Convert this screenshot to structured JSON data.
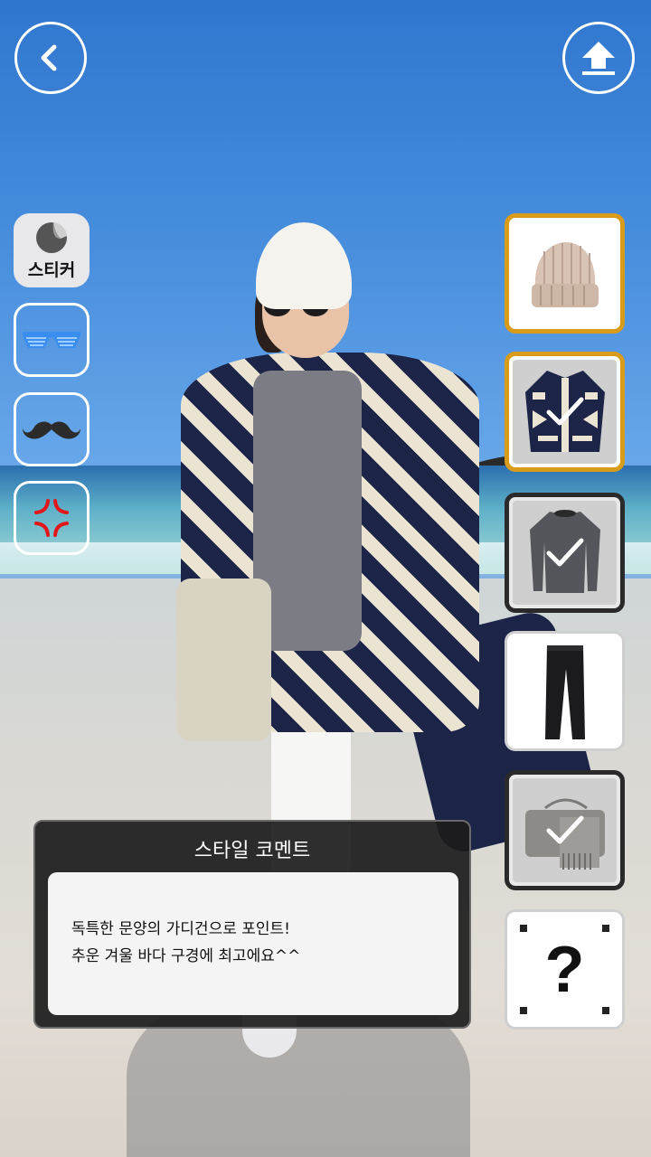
{
  "header": {
    "back_icon": "chevron-left-icon",
    "upload_icon": "upload-icon"
  },
  "stickers": {
    "main_label": "스티커",
    "items": [
      {
        "icon": "glasses-icon"
      },
      {
        "icon": "mustache-icon"
      },
      {
        "icon": "anger-mark-icon"
      }
    ]
  },
  "outfit_items": [
    {
      "name": "beanie",
      "selected": false,
      "highlight": true
    },
    {
      "name": "cardigan",
      "selected": true,
      "highlight": true
    },
    {
      "name": "sweater",
      "selected": true,
      "highlight": false
    },
    {
      "name": "jeans",
      "selected": false,
      "highlight": false
    },
    {
      "name": "bag",
      "selected": true,
      "highlight": false
    },
    {
      "name": "mystery",
      "selected": false,
      "highlight": false
    }
  ],
  "mystery_symbol": "?",
  "comment": {
    "title": "스타일 코멘트",
    "line1": "독특한 문양의 가디건으로 포인트!",
    "line2": "추운 겨울 바다 구경에 최고에요^^"
  },
  "colors": {
    "accent_gold": "#d89b1a",
    "dark_border": "#2a2a2a",
    "sticker_blue": "#3a8ef0",
    "anger_red": "#e0161b"
  }
}
